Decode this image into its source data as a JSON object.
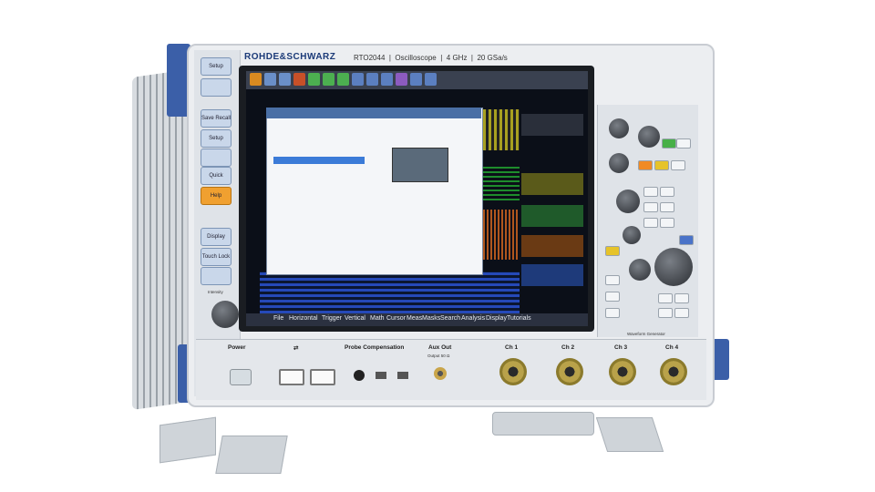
{
  "brand": "ROHDE&SCHWARZ",
  "model": "RTO2044",
  "product_line": "Oscilloscope",
  "bandwidth": "4 GHz",
  "sample_rate": "20 GSa/s",
  "left_buttons": [
    "Setup",
    "Save Recall",
    "Setup",
    "Quick Action",
    "Help",
    "Display",
    "Touch Lock",
    "Intensity"
  ],
  "menu": [
    "File",
    "Horizontal",
    "Trigger",
    "Vertical",
    "Math",
    "Cursor",
    "Meas",
    "Masks",
    "Search",
    "Analysis",
    "Display",
    "Tutorials"
  ],
  "front_panel": {
    "power_label": "Power",
    "probe_comp_label": "Probe Compensation",
    "aux_out_label": "Aux Out",
    "aux_out_sub": "Output 50 Ω",
    "channels": [
      "Ch 1",
      "Ch 2",
      "Ch 3",
      "Ch 4"
    ],
    "waveform_generator_label": "Waveform Generator"
  },
  "colors": {
    "brand_blue": "#1b3a78",
    "screen_bg": "#0b0f18",
    "accent_orange": "#f0a030",
    "bracket_blue": "#3b5fa8"
  }
}
